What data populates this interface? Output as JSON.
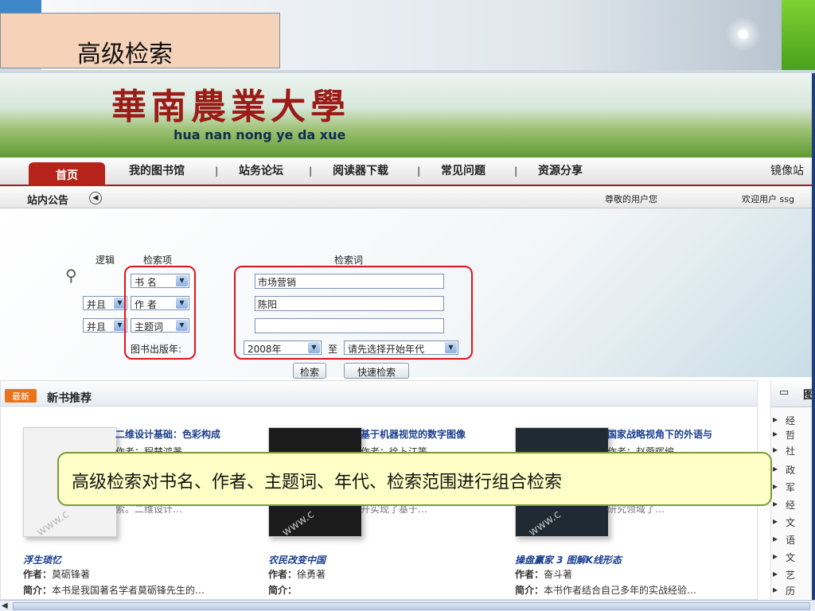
{
  "slide": {
    "title": "高级检索",
    "callout": "高级检索对书名、作者、主题词、年代、检索范围进行组合检索"
  },
  "site": {
    "name_calligraphy": "華南農業大學",
    "name_pinyin": "hua nan nong ye da xue"
  },
  "nav": {
    "items": [
      "首页",
      "我的图书馆",
      "站务论坛",
      "阅读器下载",
      "常见问题",
      "资源分享"
    ],
    "separator": "|",
    "right": "镜像站"
  },
  "notice": {
    "label": "站内公告",
    "greeting": "尊敬的用户您",
    "welcome": "欢迎用户 ssg"
  },
  "search": {
    "col_logic": "逻辑",
    "col_field": "检索项",
    "col_term": "检索词",
    "rows": [
      {
        "logic": "",
        "field": "书  名",
        "term": "市场营销"
      },
      {
        "logic": "并且",
        "field": "作  者",
        "term": "陈阳"
      },
      {
        "logic": "并且",
        "field": "主题词",
        "term": ""
      }
    ],
    "year_label": "图书出版年:",
    "year_from": "2008年",
    "year_to_label": "至",
    "year_to": "请先选择开始年代",
    "search_button": "检索",
    "quick_button": "快速检索"
  },
  "books": {
    "badge": "最新",
    "title": "新书推荐",
    "author_label": "作者：",
    "intro_label": "简介：",
    "top": [
      {
        "title": "二维设计基础：色彩构成",
        "author_line": "作者：程楚鸿著",
        "intro_tail": "索。二维设计…"
      },
      {
        "title": "基于机器视觉的数字图像",
        "author_line": "作者：徐卜江等",
        "intro_tail": "开实现了基于…"
      },
      {
        "title": "国家战略视角下的外语与",
        "author_line": "作者：赵蓉晖编",
        "intro_tail": "研究领域了…"
      }
    ],
    "bottom": [
      {
        "title": "浮生琐忆",
        "author": "莫砺锋著",
        "intro": "本书是我国著名学者莫砺锋先生的…"
      },
      {
        "title": "农民改变中国",
        "author": "徐勇著",
        "intro": ""
      },
      {
        "title": "操盘赢家 3 图解K线形态",
        "author": "奋斗著",
        "intro": "本书作者结合自己多年的实战经验…"
      }
    ],
    "covers": [
      {
        "color": "#f2f2f2",
        "watermark": "www.c"
      },
      {
        "color": "#1b1b1b",
        "watermark": "www.c"
      },
      {
        "color": "#1f2a33",
        "watermark": "www.c"
      }
    ]
  },
  "right_column": {
    "head": "图",
    "items": [
      "经",
      "哲",
      "社",
      "政",
      "军",
      "经",
      "文",
      "语",
      "文",
      "艺",
      "历"
    ]
  },
  "colors": {
    "accent_red": "#b5231a",
    "highlight_red": "#e0141c",
    "callout_bg": "#ffffc8"
  }
}
